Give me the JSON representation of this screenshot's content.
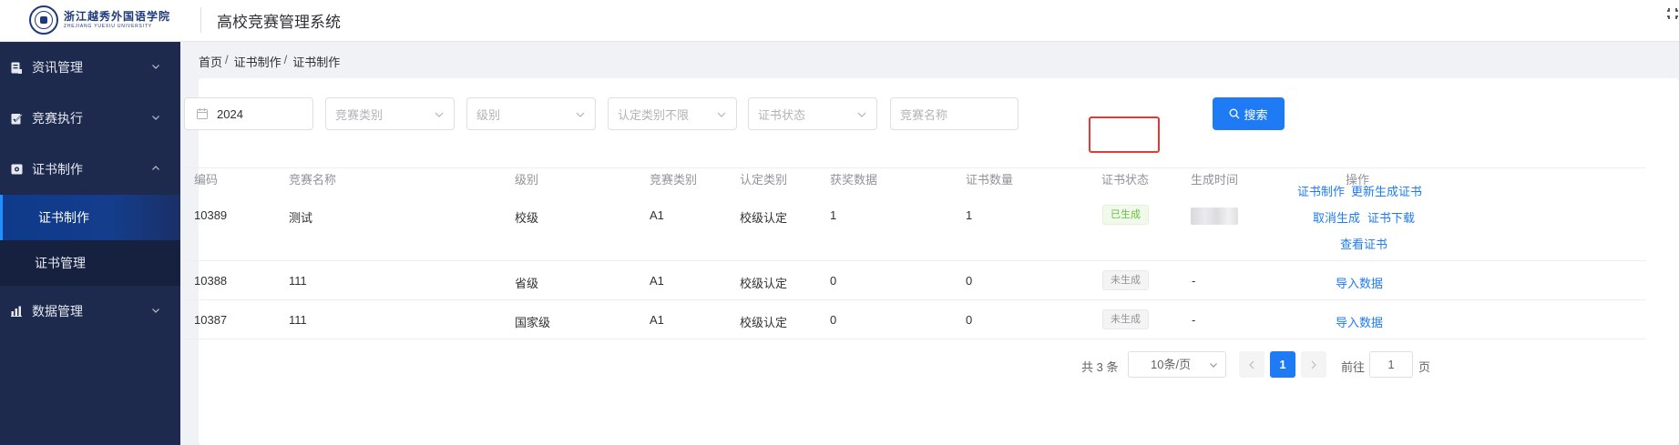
{
  "header": {
    "logo_cn": "浙江越秀外国语学院",
    "logo_en": "ZHEJIANG YUEXIU UNIVERSITY",
    "app_title": "高校竞赛管理系统"
  },
  "sidebar": {
    "items": [
      {
        "label": "资讯管理",
        "icon": "news-icon",
        "expanded": false
      },
      {
        "label": "竞赛执行",
        "icon": "edit-icon",
        "expanded": false
      },
      {
        "label": "证书制作",
        "icon": "certificate-icon",
        "expanded": true,
        "children": [
          {
            "label": "证书制作",
            "active": true
          },
          {
            "label": "证书管理",
            "active": false
          }
        ]
      },
      {
        "label": "数据管理",
        "icon": "bar-chart-icon",
        "expanded": false
      }
    ]
  },
  "breadcrumb": {
    "items": [
      "首页",
      "证书制作",
      "证书制作"
    ],
    "separator": "/"
  },
  "filters": {
    "year": {
      "value": "2024",
      "icon": "calendar-icon"
    },
    "competition_type": {
      "placeholder": "竞赛类别"
    },
    "level": {
      "placeholder": "级别"
    },
    "recognition_type": {
      "placeholder": "认定类别不限"
    },
    "certificate_status": {
      "placeholder": "证书状态"
    },
    "competition_name": {
      "placeholder": "竞赛名称"
    },
    "search_label": "搜索"
  },
  "table": {
    "columns": [
      "编码",
      "竞赛名称",
      "级别",
      "竞赛类别",
      "认定类别",
      "获奖数据",
      "证书数量",
      "证书状态",
      "生成时间",
      "操作"
    ],
    "rows": [
      {
        "code": "10389",
        "name": "测试",
        "level": "校级",
        "category": "A1",
        "recognition": "校级认定",
        "award_count": "1",
        "cert_count": "1",
        "status": "已生成",
        "status_kind": "done",
        "generated_at": "",
        "actions": [
          "证书制作",
          "更新生成证书",
          "取消生成",
          "证书下载",
          "查看证书"
        ]
      },
      {
        "code": "10388",
        "name": "111",
        "level": "省级",
        "category": "A1",
        "recognition": "校级认定",
        "award_count": "0",
        "cert_count": "0",
        "status": "未生成",
        "status_kind": "pending",
        "generated_at": "-",
        "actions": [
          "导入数据"
        ]
      },
      {
        "code": "10387",
        "name": "111",
        "level": "国家级",
        "category": "A1",
        "recognition": "校级认定",
        "award_count": "0",
        "cert_count": "0",
        "status": "未生成",
        "status_kind": "pending",
        "generated_at": "-",
        "actions": [
          "导入数据"
        ]
      }
    ]
  },
  "pagination": {
    "total_text": "共 3 条",
    "page_size": "10条/页",
    "current_page": "1",
    "goto_label": "前往",
    "goto_value": "1",
    "goto_suffix": "页"
  },
  "colors": {
    "primary": "#1e7bf3",
    "sidebar_bg": "#1d2a4d",
    "success": "#67c23a",
    "highlight_border": "#e53935"
  }
}
